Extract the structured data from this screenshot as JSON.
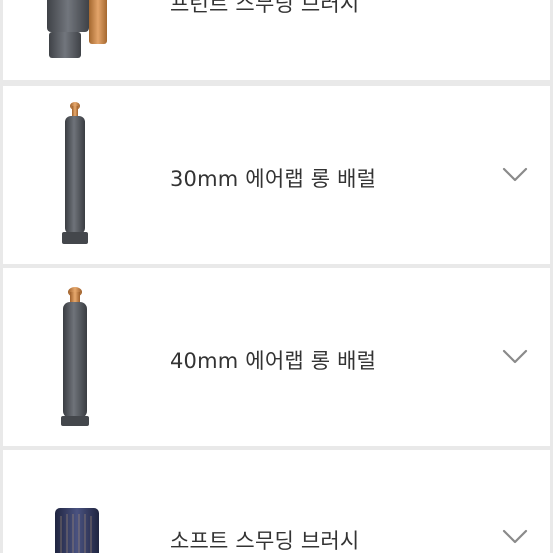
{
  "accessories": [
    {
      "label": "프런트 스무딩 브러시",
      "image": "hair-tool-attachment-icon",
      "expand_icon": "chevron-down-icon"
    },
    {
      "label": "30mm 에어랩 롱 배럴",
      "image": "long-barrel-30mm-icon",
      "expand_icon": "chevron-down-icon"
    },
    {
      "label": "40mm 에어랩 롱 배럴",
      "image": "long-barrel-40mm-icon",
      "expand_icon": "chevron-down-icon"
    },
    {
      "label": "소프트 스무딩 브러시",
      "image": "soft-smoothing-brush-icon",
      "expand_icon": "chevron-down-icon"
    }
  ],
  "colors": {
    "background": "#e9e9e9",
    "card": "#ffffff",
    "text": "#333333",
    "chevron": "#8a8a8a",
    "barrel_gray": "#5b5f66",
    "copper": "#c98a52",
    "navy": "#2e3559"
  }
}
